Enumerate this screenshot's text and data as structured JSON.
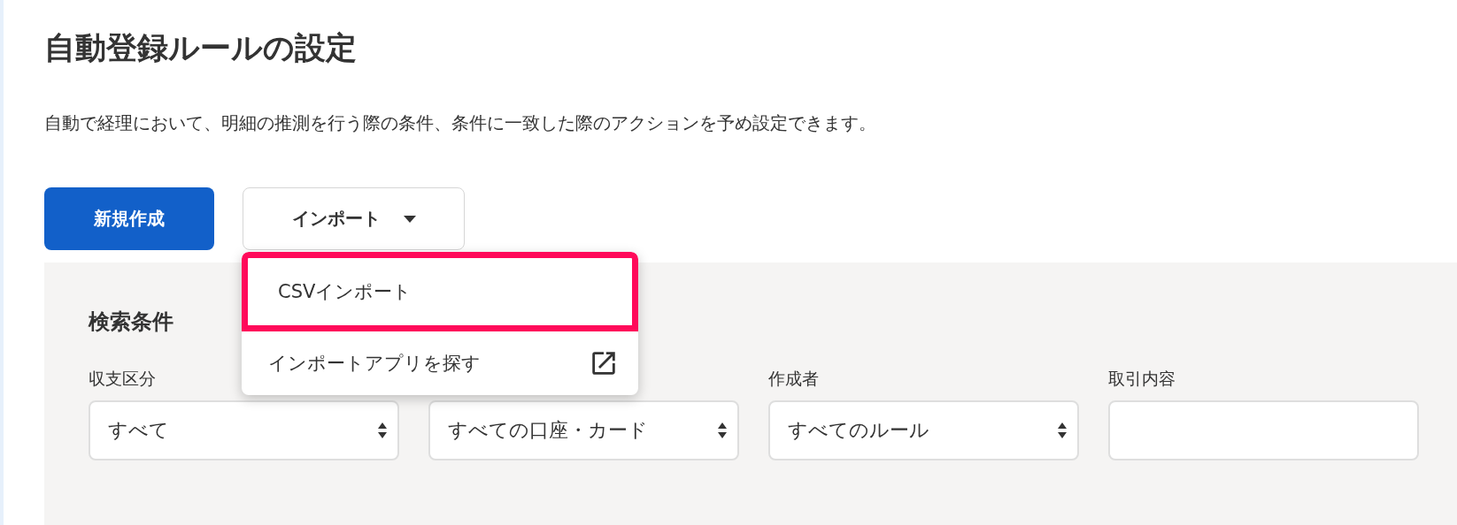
{
  "title": "自動登録ルールの設定",
  "description": "自動で経理において、明細の推測を行う際の条件、条件に一致した際のアクションを予め設定できます。",
  "new_button": "新規作成",
  "import_button": {
    "label": "インポート",
    "expanded": true
  },
  "import_menu": [
    {
      "label": "CSVインポート",
      "highlighted": true,
      "kind": "plain"
    },
    {
      "label": "インポートアプリを探す",
      "highlighted": false,
      "kind": "external"
    }
  ],
  "search": {
    "heading": "検索条件",
    "filters": [
      {
        "label": "収支区分",
        "kind": "select",
        "value": "すべて"
      },
      {
        "kind": "select",
        "value": "すべての口座・カード"
      },
      {
        "label": "作成者",
        "kind": "select",
        "value": "すべてのルール"
      },
      {
        "label": "取引内容",
        "kind": "text"
      }
    ]
  }
}
